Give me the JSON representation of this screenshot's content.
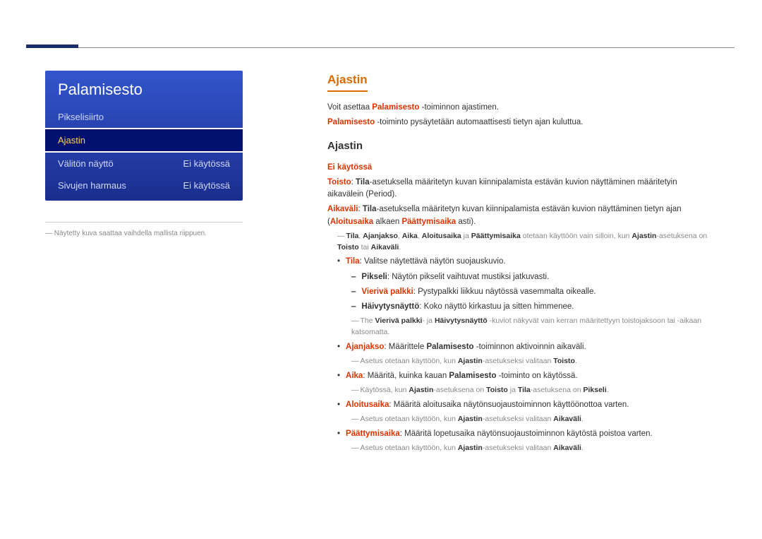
{
  "menu": {
    "title": "Palamisesto",
    "items": [
      {
        "label": "Pikselisiirto",
        "value": ""
      },
      {
        "label": "Ajastin",
        "value": "",
        "selected": true
      },
      {
        "label": "Välitön näyttö",
        "value": "Ei käytössä"
      },
      {
        "label": "Sivujen harmaus",
        "value": "Ei käytössä"
      }
    ]
  },
  "footnote": "Näytetty kuva saattaa vaihdella mallista riippuen.",
  "content": {
    "title": "Ajastin",
    "intro1_a": "Voit asettaa ",
    "intro1_b": "Palamisesto",
    "intro1_c": " -toiminnon ajastimen.",
    "intro2_a": "Palamisesto",
    "intro2_b": " -toiminto pysäytetään automaattisesti tietyn ajan kuluttua.",
    "subheading": "Ajastin",
    "eikaytossa": "Ei käytössä",
    "toisto_a": "Toisto",
    "toisto_b": ": ",
    "toisto_c": "Tila",
    "toisto_d": "-asetuksella määritetyn kuvan kiinnipalamista estävän kuvion näyttäminen määritetyin aikavälein (Period).",
    "aikavali_a": "Aikaväli",
    "aikavali_b": ": ",
    "aikavali_c": "Tila",
    "aikavali_d": "-asetuksella määritetyn kuvan kiinnipalamista estävän kuvion näyttäminen tietyn ajan (",
    "aikavali_e": "Aloitusaika",
    "aikavali_f": " alkaen ",
    "aikavali_g": "Päättymisaika",
    "aikavali_h": " asti).",
    "note1_a": "Tila",
    "note1_b": ", ",
    "note1_c": "Ajanjakso",
    "note1_d": ", ",
    "note1_e": "Aika",
    "note1_f": ", ",
    "note1_g": "Aloitusaika",
    "note1_h": " ja ",
    "note1_i": "Päättymisaika",
    "note1_j": " otetaan käyttöön vain silloin, kun ",
    "note1_k": "Ajastin",
    "note1_l": "-asetuksena on ",
    "note1_m": "Toisto",
    "note1_n": " tai ",
    "note1_o": "Aikaväli",
    "note1_p": ".",
    "tila_a": "Tila",
    "tila_b": ": Valitse näytettävä näytön suojauskuvio.",
    "pikseli_a": "Pikseli",
    "pikseli_b": ": Näytön pikselit vaihtuvat mustiksi jatkuvasti.",
    "vieriva_a": "Vierivä palkki",
    "vieriva_b": ": Pystypalkki liikkuu näytössä vasemmalta oikealle.",
    "haivy_a": "Häivytysnäyttö",
    "haivy_b": ": Koko näyttö kirkastuu ja sitten himmenee.",
    "note2_a": "The ",
    "note2_b": "Vierivä palkki",
    "note2_c": "- ja ",
    "note2_d": "Häivytysnäyttö",
    "note2_e": " -kuviot näkyvät vain kerran määritettyyn toistojaksoon tai -aikaan katsomatta.",
    "ajanjakso_a": "Ajanjakso",
    "ajanjakso_b": ": Määrittele ",
    "ajanjakso_c": "Palamisesto",
    "ajanjakso_d": " -toiminnon aktivoinnin aikaväli.",
    "note3_a": "Asetus otetaan käyttöön, kun ",
    "note3_b": "Ajastin",
    "note3_c": "-asetukseksi valitaan ",
    "note3_d": "Toisto",
    "note3_e": ".",
    "aika_a": "Aika",
    "aika_b": ": Määritä, kuinka kauan ",
    "aika_c": "Palamisesto",
    "aika_d": " -toiminto on käytössä.",
    "note4_a": "Käytössä, kun ",
    "note4_b": "Ajastin",
    "note4_c": "-asetuksena on ",
    "note4_d": "Toisto",
    "note4_e": " ja ",
    "note4_f": "Tila",
    "note4_g": "-asetuksena on ",
    "note4_h": "Pikseli",
    "note4_i": ".",
    "aloitus_a": "Aloitusaika",
    "aloitus_b": ": Määritä aloitusaika näytönsuojaustoiminnon käyttöönottoa varten.",
    "note5_a": "Asetus otetaan käyttöön, kun ",
    "note5_b": "Ajastin",
    "note5_c": "-asetukseksi valitaan ",
    "note5_d": "Aikaväli",
    "note5_e": ".",
    "paatty_a": "Päättymisaika",
    "paatty_b": ": Määritä lopetusaika näytönsuojaustoiminnon käytöstä poistoa varten.",
    "note6_a": "Asetus otetaan käyttöön, kun ",
    "note6_b": "Ajastin",
    "note6_c": "-asetukseksi valitaan ",
    "note6_d": "Aikaväli",
    "note6_e": "."
  }
}
